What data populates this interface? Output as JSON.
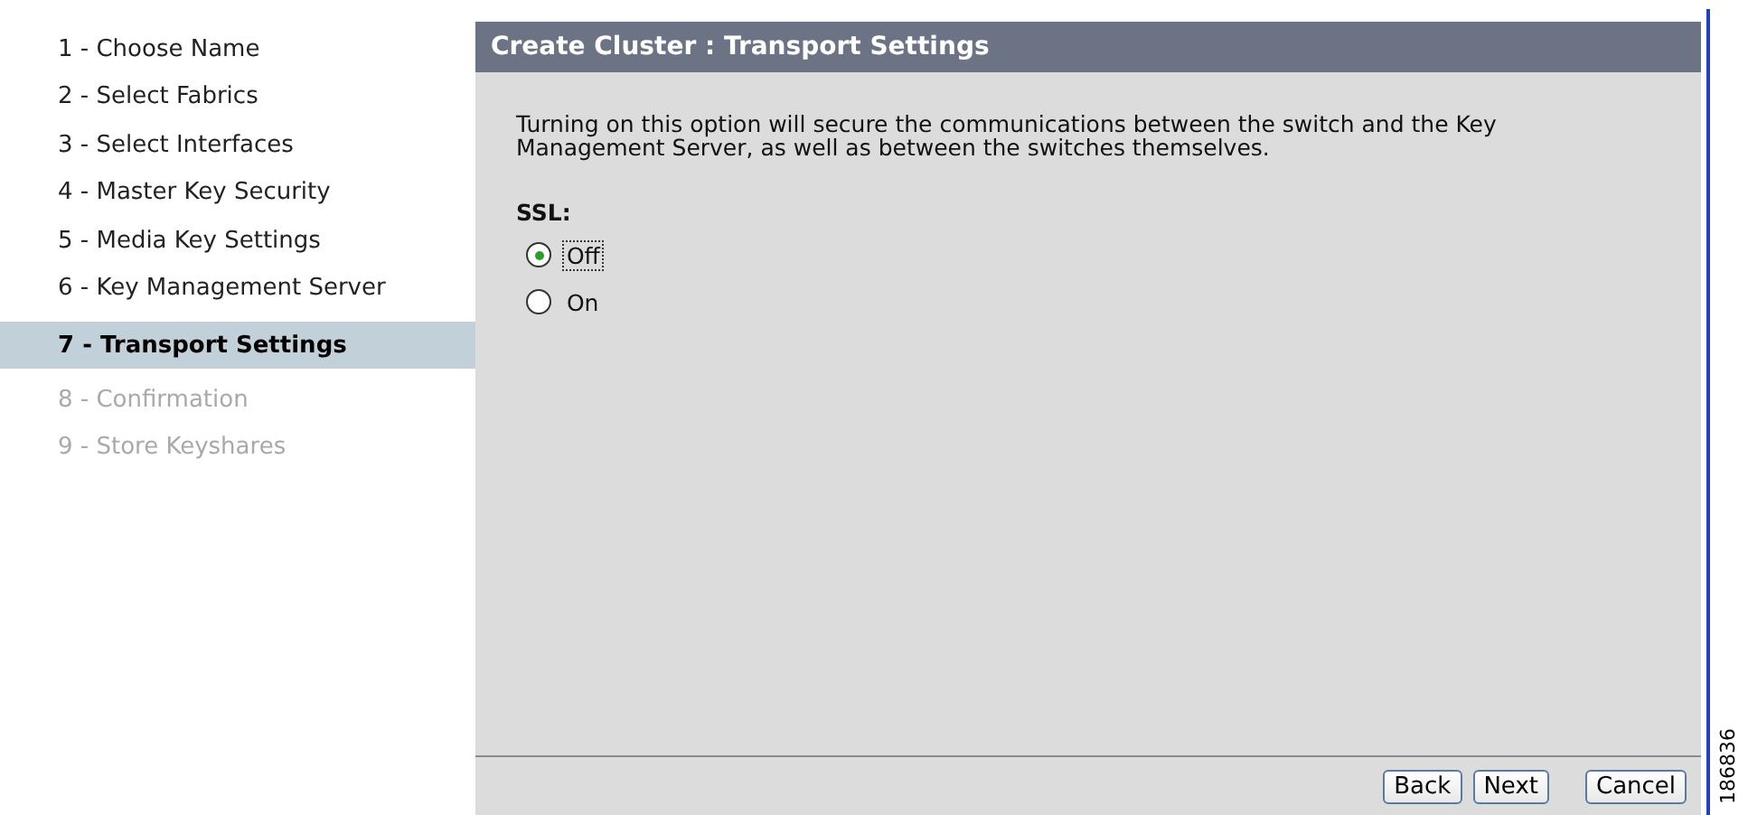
{
  "steps": [
    {
      "label": "1 - Choose Name",
      "selected": false,
      "disabled": false
    },
    {
      "label": "2 - Select Fabrics",
      "selected": false,
      "disabled": false
    },
    {
      "label": "3 - Select Interfaces",
      "selected": false,
      "disabled": false
    },
    {
      "label": "4 - Master Key Security",
      "selected": false,
      "disabled": false
    },
    {
      "label": "5 - Media Key Settings",
      "selected": false,
      "disabled": false
    },
    {
      "label": "6 - Key Management Server",
      "selected": false,
      "disabled": false
    },
    {
      "label": "7 - Transport Settings",
      "selected": true,
      "disabled": false
    },
    {
      "label": "8 - Confirmation",
      "selected": false,
      "disabled": true
    },
    {
      "label": "9 - Store Keyshares",
      "selected": false,
      "disabled": true
    }
  ],
  "panel": {
    "title": "Create Cluster : Transport Settings",
    "description": "Turning on this option will secure the communications between the switch and the Key Management Server, as well as between the switches themselves.",
    "ssl_label": "SSL:",
    "options": [
      {
        "label": "Off",
        "selected": true,
        "focused": true
      },
      {
        "label": "On",
        "selected": false,
        "focused": false
      }
    ]
  },
  "buttons": [
    "Back",
    "Next",
    "Cancel"
  ],
  "figure_number": "186836"
}
